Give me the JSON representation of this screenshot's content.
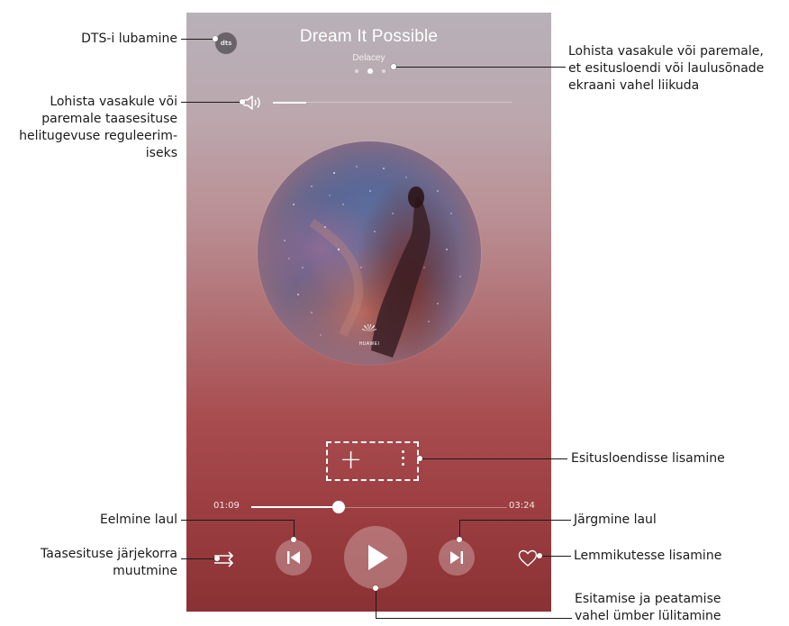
{
  "player": {
    "title": "Dream It Possible",
    "artist": "Delacey",
    "dts_label": "dts",
    "brand": "HUAWEI",
    "elapsed": "01:09",
    "duration": "03:24",
    "progress_fraction": 0.34,
    "volume_fraction": 0.14,
    "page_indicator": {
      "pages": 3,
      "active_index": 1
    },
    "accent": "#ffffff"
  },
  "callouts": {
    "dts": "DTS-i lubamine",
    "swipe_pages": [
      "Lohista vasakule või paremale,",
      "et esitusloendi või laulusõnade",
      "ekraani vahel liikuda"
    ],
    "volume": [
      "Lohista vasakule või",
      "paremale taasesituse",
      "helitugevuse reguleerim-",
      "iseks"
    ],
    "add_playlist": "Esitusloendisse lisamine",
    "previous": "Eelmine laul",
    "next": "Järgmine laul",
    "play_order": [
      "Taasesituse järjekorra",
      "muutmine"
    ],
    "favorite": "Lemmikutesse lisamine",
    "play_pause": [
      "Esitamise ja peatamise",
      "vahel ümber lülitamine"
    ]
  },
  "icons": {
    "dts": "dts-icon",
    "volume": "speaker-icon",
    "add": "plus-icon",
    "more": "more-vertical-icon",
    "previous": "skip-previous-icon",
    "play": "play-icon",
    "next": "skip-next-icon",
    "shuffle": "shuffle-icon",
    "favorite": "heart-outline-icon"
  }
}
